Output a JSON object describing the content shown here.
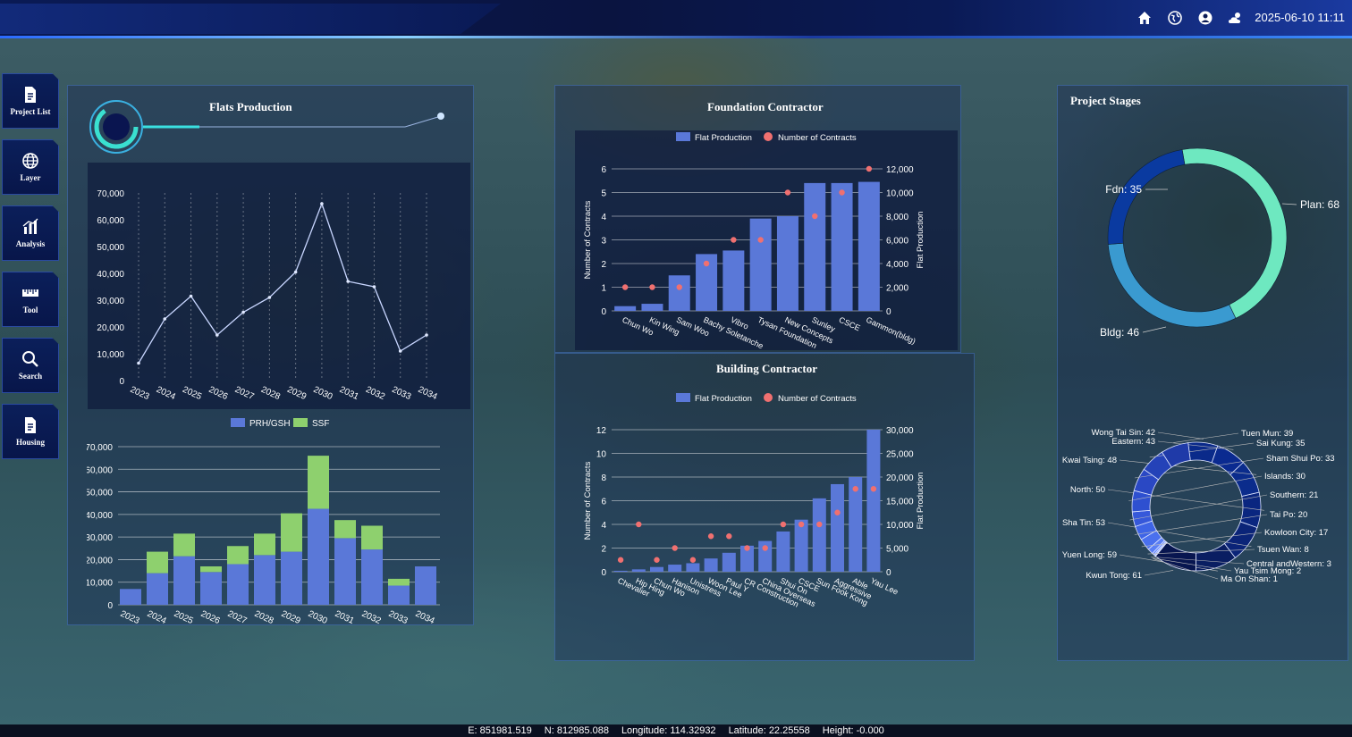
{
  "header": {
    "datetime": "2025-06-10 11:11",
    "icons": [
      "home-icon",
      "globe-icon",
      "user-icon",
      "weather-icon"
    ]
  },
  "sidebar": {
    "items": [
      {
        "label": "Project List",
        "icon": "document-icon"
      },
      {
        "label": "Layer",
        "icon": "globe-icon"
      },
      {
        "label": "Analysis",
        "icon": "bar-chart-icon"
      },
      {
        "label": "Tool",
        "icon": "ruler-icon"
      },
      {
        "label": "Search",
        "icon": "search-icon"
      },
      {
        "label": "Housing",
        "icon": "document-icon"
      }
    ]
  },
  "panels": {
    "flats_title": "Flats Production",
    "foundation_title": "Foundation Contractor",
    "building_title": "Building Contractor",
    "stages_title": "Project Stages"
  },
  "status": {
    "e": "E: 851981.519",
    "n": "N: 812985.088",
    "lon": "Longitude: 114.32932",
    "lat": "Latitude: 22.25558",
    "height": "Height: -0.000"
  },
  "colors": {
    "bar": "#5a78d8",
    "scatter": "#f07070",
    "prh": "#5a78d8",
    "ssf": "#8ed06e",
    "donut_plan": "#6ee8c0",
    "donut_fdn": "#0a3aa0",
    "donut_bldg": "#3a9ad0"
  },
  "chart_data": [
    {
      "type": "line",
      "x": [
        "2023",
        "2024",
        "2025",
        "2026",
        "2027",
        "2028",
        "2029",
        "2030",
        "2031",
        "2032",
        "2033",
        "2034"
      ],
      "values": [
        6500,
        23000,
        31500,
        17000,
        25500,
        31000,
        40500,
        66000,
        37000,
        35000,
        11000,
        17000
      ],
      "ylim": [
        0,
        70000
      ],
      "yticks": [
        "0",
        "10,000",
        "20,000",
        "30,000",
        "40,000",
        "50,000",
        "60,000",
        "70,000"
      ]
    },
    {
      "type": "bar",
      "categories": [
        "2023",
        "2024",
        "2025",
        "2026",
        "2027",
        "2028",
        "2029",
        "2030",
        "2031",
        "2032",
        "2033",
        "2034"
      ],
      "series": [
        {
          "name": "PRH/GSH",
          "values": [
            7000,
            14000,
            21500,
            14500,
            18000,
            22000,
            23500,
            42500,
            29500,
            24500,
            8500,
            17000
          ]
        },
        {
          "name": "SSF",
          "values": [
            0,
            9500,
            10000,
            2500,
            8000,
            9500,
            17000,
            23500,
            8000,
            10500,
            3000,
            0
          ]
        }
      ],
      "ylim": [
        0,
        70000
      ],
      "yticks": [
        "0",
        "10,000",
        "20,000",
        "30,000",
        "40,000",
        "50,000",
        "60,000",
        "70,000"
      ]
    },
    {
      "type": "bar",
      "categories": [
        "Chun Wo",
        "Kin Wing",
        "Sam Woo",
        "Bachy Soletanche",
        "Vibro",
        "Tysan Foundation",
        "New Concepts",
        "Sunley",
        "CSCE",
        "Gammon(bldg)"
      ],
      "series": [
        {
          "name": "Flat Production",
          "values": [
            400,
            600,
            3000,
            4800,
            5100,
            7800,
            8000,
            10800,
            10800,
            10900
          ]
        },
        {
          "name": "Number of Contracts",
          "values": [
            1,
            1,
            1,
            2,
            3,
            3,
            5,
            4,
            5,
            6
          ]
        }
      ],
      "ylabel": "Number of Contracts",
      "y2label": "Flat Production",
      "ylim": [
        0,
        6
      ],
      "y2lim": [
        0,
        12000
      ],
      "yticks": [
        "0",
        "1",
        "2",
        "3",
        "4",
        "5",
        "6"
      ],
      "y2ticks": [
        "0",
        "2,000",
        "4,000",
        "6,000",
        "8,000",
        "10,000",
        "12,000"
      ]
    },
    {
      "type": "bar",
      "categories": [
        "Chevalier",
        "Hip Hing",
        "Chun Wo",
        "Hanison",
        "Unistress",
        "Woon Lee",
        "Paul Y",
        "CR Construction",
        "China Overseas",
        "Shui On",
        "CSCE",
        "Sun Fook Kong",
        "Aggressive",
        "Able",
        "Yau Lee"
      ],
      "series": [
        {
          "name": "Flat Production",
          "values": [
            200,
            500,
            1000,
            1500,
            1800,
            2800,
            4000,
            5500,
            6500,
            8500,
            11000,
            15500,
            18500,
            20000,
            30000
          ]
        },
        {
          "name": "Number of Contracts",
          "values": [
            1,
            4,
            1,
            2,
            1,
            3,
            3,
            2,
            2,
            4,
            4,
            4,
            5,
            7,
            7
          ]
        }
      ],
      "ylabel": "Number of Contracts",
      "y2label": "Flat Production",
      "ylim": [
        0,
        12
      ],
      "y2lim": [
        0,
        30000
      ],
      "yticks": [
        "0",
        "2",
        "4",
        "6",
        "8",
        "10",
        "12"
      ],
      "y2ticks": [
        "0",
        "5,000",
        "10,000",
        "15,000",
        "20,000",
        "25,000",
        "30,000"
      ]
    },
    {
      "type": "pie",
      "labels": [
        "Plan: 68",
        "Bldg: 46",
        "Fdn: 35"
      ],
      "values": [
        68,
        46,
        35
      ]
    },
    {
      "type": "pie",
      "labels": [
        "Wong Tai Sin: 42",
        "Eastern: 43",
        "Kwai Tsing: 48",
        "North: 50",
        "Sha Tin: 53",
        "Yuen Long: 59",
        "Kwun Tong: 61",
        "Ma On Shan: 1",
        "Yau Tsim Mong: 2",
        "Central andWestern: 3",
        "Tsuen Wan: 8",
        "Kowloon City: 17",
        "Tai Po: 20",
        "Southern: 21",
        "Islands: 30",
        "Sham Shui Po: 33",
        "Sai Kung: 35",
        "Tuen Mun: 39"
      ],
      "values": [
        42,
        43,
        48,
        50,
        53,
        59,
        61,
        1,
        2,
        3,
        8,
        17,
        20,
        21,
        30,
        33,
        35,
        39
      ]
    }
  ]
}
